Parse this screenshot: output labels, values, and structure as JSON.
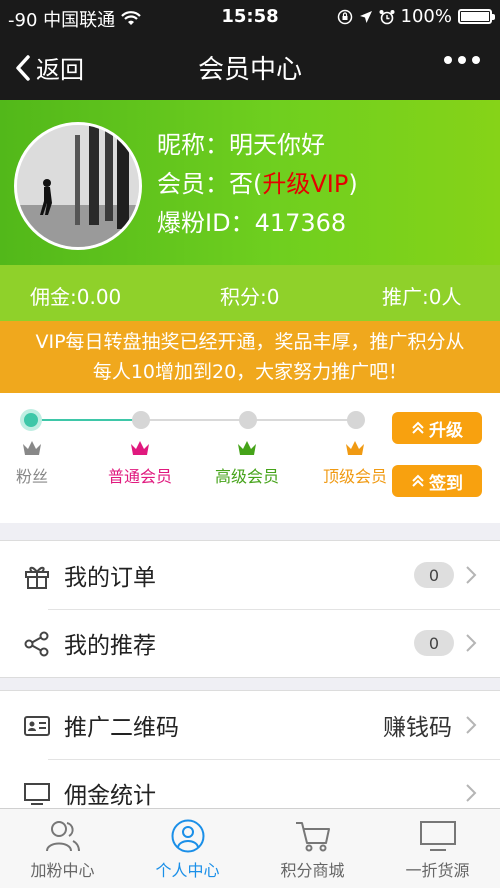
{
  "status": {
    "carrier": "-90 中国联通",
    "time": "15:58",
    "battery": "100%"
  },
  "nav": {
    "back_label": "返回",
    "title": "会员中心"
  },
  "profile": {
    "nickname_label": "昵称：",
    "nickname": "明天你好",
    "member_label": "会员：",
    "member_status": "否(",
    "upgrade_link": "升级VIP",
    "member_close": ")",
    "id_label": "爆粉ID：",
    "id_value": "417368"
  },
  "stats": {
    "commission": "佣金:0.00",
    "points": "积分:0",
    "referrals": "推广:0人"
  },
  "notice": {
    "line1": "VIP每日转盘抽奖已经开通，奖品丰厚，推广积分从",
    "line2": "每人10增加到20，大家努力推广吧！"
  },
  "levels": {
    "items": [
      {
        "label": "粉丝",
        "color": "#888888"
      },
      {
        "label": "普通会员",
        "color": "#e0197e"
      },
      {
        "label": "高级会员",
        "color": "#45a319"
      },
      {
        "label": "顶级会员",
        "color": "#f09a13"
      }
    ],
    "current_index": 0,
    "upgrade_button": "升级",
    "signin_button": "签到"
  },
  "menu": {
    "orders_label": "我的订单",
    "orders_count": "0",
    "recommend_label": "我的推荐",
    "recommend_count": "0",
    "qrcode_label": "推广二维码",
    "qrcode_value": "赚钱码",
    "commission_label": "佣金统计"
  },
  "tabbar": {
    "items": [
      {
        "label": "加粉中心",
        "icon": "users-icon"
      },
      {
        "label": "个人中心",
        "icon": "user-icon"
      },
      {
        "label": "积分商城",
        "icon": "cart-icon"
      },
      {
        "label": "一折货源",
        "icon": "monitor-icon"
      }
    ],
    "active_index": 1
  },
  "colors": {
    "green": "#6fcf1f",
    "orange": "#f0a81d",
    "teal": "#3ec7a8",
    "blue": "#1a8fe8"
  }
}
